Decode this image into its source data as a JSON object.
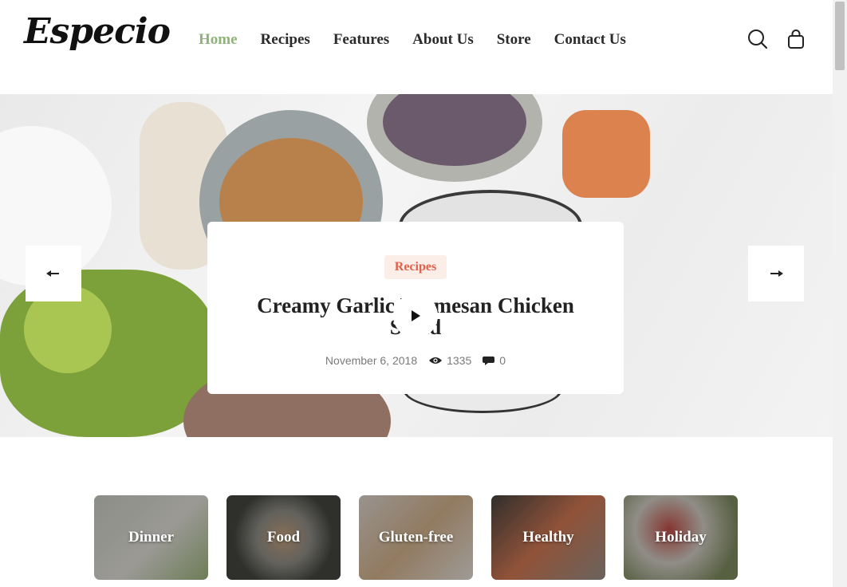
{
  "header": {
    "logo": "Especio",
    "nav": [
      {
        "label": "Home",
        "active": true
      },
      {
        "label": "Recipes",
        "active": false
      },
      {
        "label": "Features",
        "active": false
      },
      {
        "label": "About Us",
        "active": false
      },
      {
        "label": "Store",
        "active": false
      },
      {
        "label": "Contact Us",
        "active": false
      }
    ],
    "icons": [
      "search-icon",
      "shopping-bag-icon"
    ]
  },
  "hero": {
    "tag": "Recipes",
    "title": "Creamy Garlic Parmesan Chicken Salad",
    "date": "November 6, 2018",
    "views": "1335",
    "comments": "0",
    "prev_icon": "arrow-left-icon",
    "next_icon": "arrow-right-icon",
    "play_icon": "play-icon"
  },
  "categories": [
    {
      "label": "Dinner"
    },
    {
      "label": "Food"
    },
    {
      "label": "Gluten-free"
    },
    {
      "label": "Healthy"
    },
    {
      "label": "Holiday"
    }
  ],
  "colors": {
    "accent": "#8fb27a",
    "tag_text": "#e0624a",
    "tag_bg": "#fbeee9"
  }
}
